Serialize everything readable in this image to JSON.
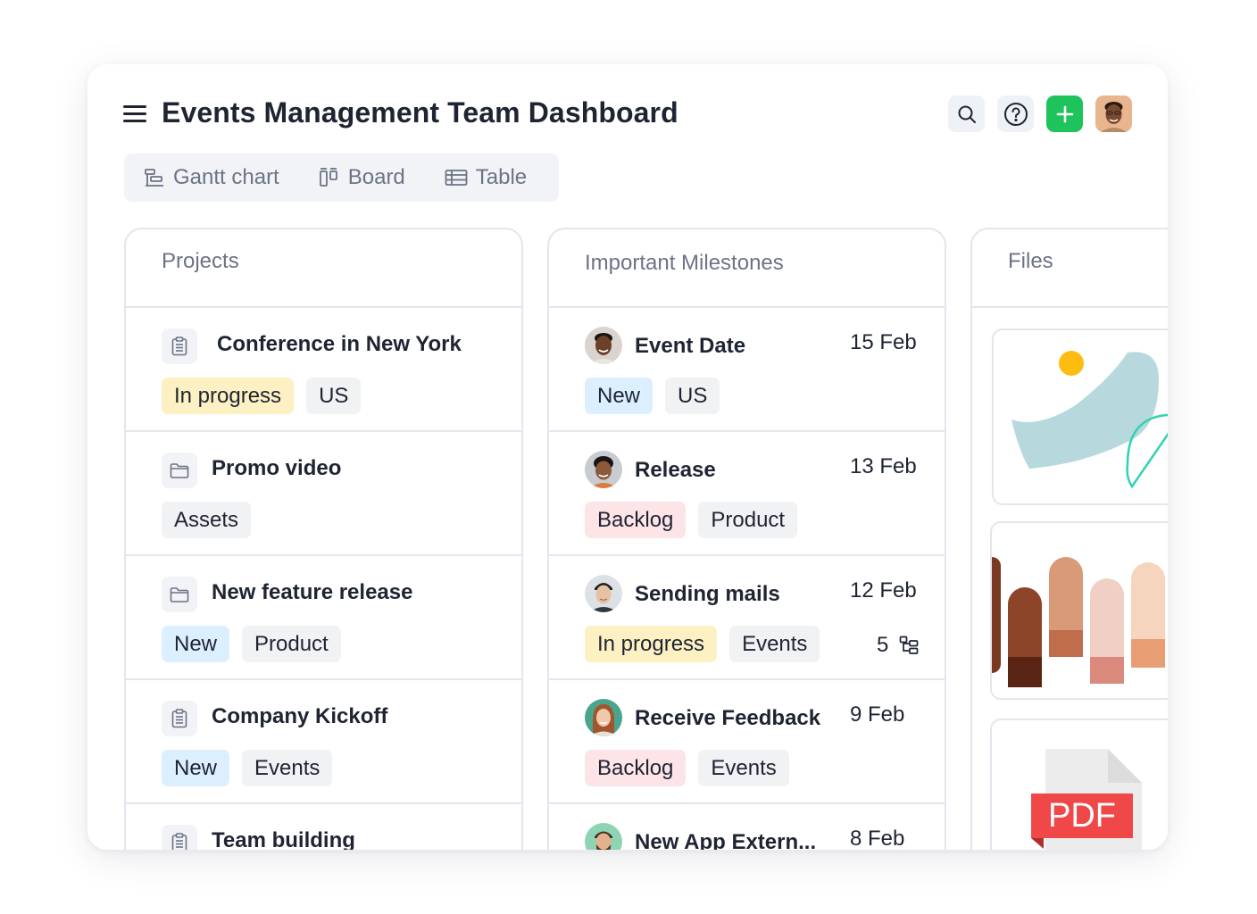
{
  "header": {
    "title": "Events Management Team Dashboard"
  },
  "views": [
    {
      "label": "Gantt chart",
      "icon": "gantt-icon"
    },
    {
      "label": "Board",
      "icon": "board-icon"
    },
    {
      "label": "Table",
      "icon": "table-icon"
    }
  ],
  "projects": {
    "heading": "Projects",
    "items": [
      {
        "title": "Conference in New York",
        "icon": "clipboard-icon",
        "tags": [
          "In progress",
          "US"
        ]
      },
      {
        "title": "Promo video",
        "icon": "folder-icon",
        "tags": [
          "Assets"
        ]
      },
      {
        "title": "New feature release",
        "icon": "folder-icon",
        "tags": [
          "New",
          "Product"
        ]
      },
      {
        "title": "Company Kickoff",
        "icon": "clipboard-icon",
        "tags": [
          "New",
          "Events"
        ]
      },
      {
        "title": "Team building",
        "icon": "clipboard-icon",
        "tags": []
      }
    ]
  },
  "milestones": {
    "heading": "Important Milestones",
    "items": [
      {
        "title": "Event Date",
        "date": "15 Feb",
        "tags": [
          "New",
          "US"
        ]
      },
      {
        "title": "Release",
        "date": "13 Feb",
        "tags": [
          "Backlog",
          "Product"
        ]
      },
      {
        "title": "Sending mails",
        "date": "12 Feb",
        "tags": [
          "In progress",
          "Events"
        ],
        "subtasks": "5"
      },
      {
        "title": "Receive Feedback",
        "date": "9 Feb",
        "tags": [
          "Backlog",
          "Events"
        ]
      },
      {
        "title": "New App Extern...",
        "date": "8 Feb",
        "tags": []
      }
    ]
  },
  "files": {
    "heading": "Files",
    "items": [
      {
        "icon": "illustration-thumbnail"
      },
      {
        "icon": "color-palette-thumbnail"
      },
      {
        "badge": "PDF",
        "icon": "pdf-file-icon"
      }
    ]
  },
  "colors": {
    "accent_green": "#1ec45b",
    "tag_yellow": "#fdf0c2",
    "tag_blue": "#dcefff",
    "tag_pink": "#fde4e7",
    "tag_gray": "#f1f2f4",
    "pdf_red": "#f04848"
  }
}
